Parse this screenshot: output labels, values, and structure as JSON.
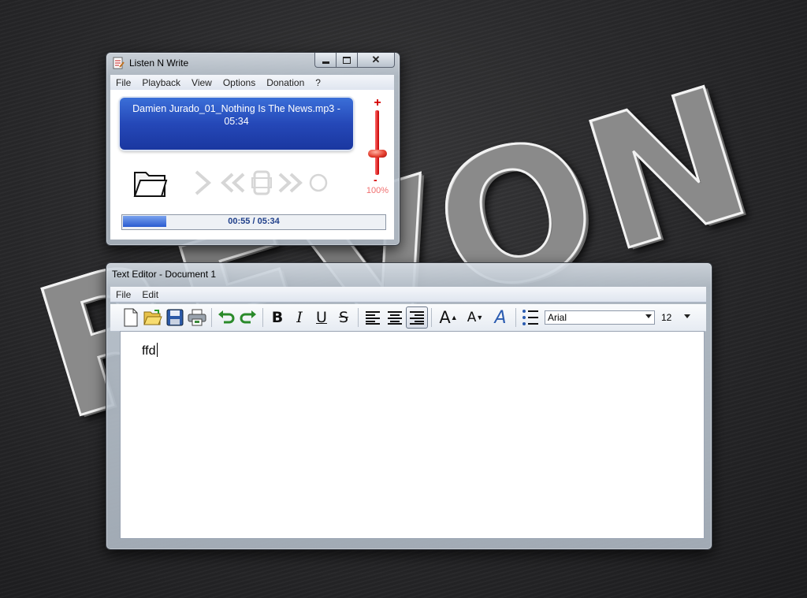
{
  "desktop": {
    "wallpaper_text": "REVON"
  },
  "player": {
    "title": "Listen N Write",
    "menu": [
      "File",
      "Playback",
      "View",
      "Options",
      "Donation",
      "?"
    ],
    "track_line1": "Damien Jurado_01_Nothing Is The News.mp3 -",
    "track_line2": "05:34",
    "volume_plus": "+",
    "volume_minus": "-",
    "volume_percent": "100%",
    "volume_level": 1.0,
    "progress_fraction": 0.165,
    "time_display": "00:55 / 05:34",
    "controls": [
      "folder-icon",
      "play-icon",
      "rewind-icon",
      "stop-icon",
      "fast-forward-icon",
      "record-icon"
    ]
  },
  "editor": {
    "title": "Text Editor - Document 1",
    "menu": [
      "File",
      "Edit"
    ],
    "font_name": "Arial",
    "font_size": "12",
    "content": "ffd",
    "toolbar": {
      "bold": "B",
      "italic": "I",
      "underline": "U",
      "strike": "S",
      "grow_font": "A",
      "shrink_font": "A",
      "font_color": "A"
    }
  },
  "colors": {
    "track_panel": "#2548b8",
    "volume_red": "#d40000",
    "progress_blue": "#2a5bd0"
  }
}
